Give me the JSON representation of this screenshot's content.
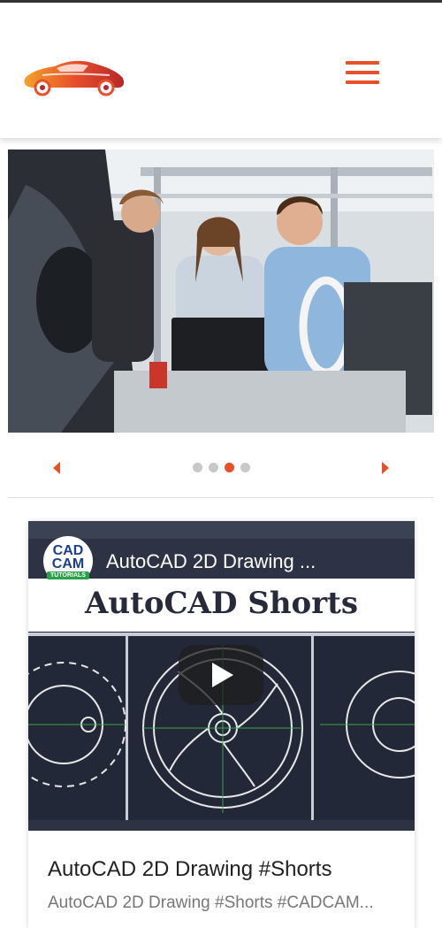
{
  "header": {
    "logo_icon": "sports-car-logo",
    "menu_icon": "hamburger-menu-icon",
    "accent_color": "#e8502a"
  },
  "slider": {
    "prev_icon": "triangle-left-icon",
    "next_icon": "triangle-right-icon",
    "dot_count": 4,
    "active_index": 2
  },
  "video_card": {
    "video_title": "AutoCAD 2D Drawing ...",
    "channel_badge": {
      "line1": "CAD",
      "line2": "CAM",
      "line3": "TUTORIALS"
    },
    "thumbnail_banner": "AutoCAD Shorts",
    "play_icon": "play-icon",
    "title": "AutoCAD 2D Drawing #Shorts",
    "description": "AutoCAD 2D Drawing #Shorts #CADCAM..."
  }
}
